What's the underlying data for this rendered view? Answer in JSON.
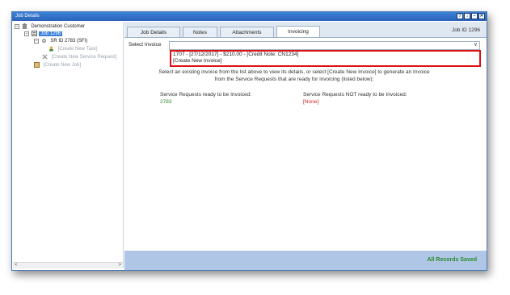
{
  "window": {
    "title": "Job Details",
    "buttons": [
      "?",
      "↓",
      "–",
      "✕"
    ]
  },
  "tree": {
    "items": [
      {
        "label": "Demonstration Customer",
        "icon": "building-icon",
        "expander": "–"
      },
      {
        "label": "Job 1296",
        "icon": "job-icon",
        "expander": "–",
        "selected": true
      },
      {
        "label": "SR ID 2783 (SFI)",
        "icon": "service-request-icon",
        "expander": "–"
      },
      {
        "label": "[Create New Task]",
        "icon": "task-icon",
        "muted": true
      },
      {
        "label": "[Create New Service Request]",
        "icon": "service-request-icon",
        "muted": true
      },
      {
        "label": "[Create New Job]",
        "icon": "job-icon",
        "muted": true
      }
    ],
    "scroll_left": "<",
    "scroll_right": ">"
  },
  "tabs": [
    {
      "label": "Job Details"
    },
    {
      "label": "Notes"
    },
    {
      "label": "Attachments"
    },
    {
      "label": "Invoicing",
      "active": true
    }
  ],
  "job_id_label": "Job ID 1296",
  "invoicing": {
    "select_label": "Select Invoice",
    "dropdown_arrow": "∨",
    "options": [
      "1707 - [27/12/2017] - $210.00 - [Credit Note: CN1234]",
      "[Create New Invoice]"
    ],
    "instructions_line1": "Select an existing invoice from the list above to view its details, or select [Create New Invoice] to generate an Invoice",
    "instructions_line2": "from the Service Requests that are ready for invoicing (listed below):",
    "ready_heading": "Service Requests ready to be Invoiced:",
    "ready_value": "2783",
    "not_ready_heading": "Service Requests NOT ready to be Invoiced:",
    "not_ready_value": "[None]"
  },
  "status": {
    "text": "All Records Saved",
    "color": "#2a8a2a"
  }
}
